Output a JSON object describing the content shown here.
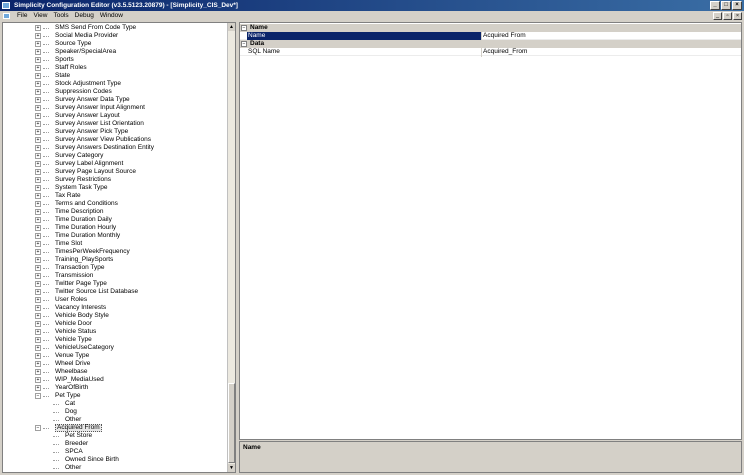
{
  "window": {
    "title": "Simplicity Configuration Editor (v3.5.5123.20879) - [Simplicity_CIS_Dev*]"
  },
  "menu": [
    "File",
    "View",
    "Tools",
    "Debug",
    "Window"
  ],
  "tree": {
    "items": [
      {
        "label": "SMS Send From Code Type",
        "level": 1,
        "expander": "+"
      },
      {
        "label": "Social Media Provider",
        "level": 1,
        "expander": "+"
      },
      {
        "label": "Source Type",
        "level": 1,
        "expander": "+"
      },
      {
        "label": "Speaker/SpecialArea",
        "level": 1,
        "expander": "+"
      },
      {
        "label": "Sports",
        "level": 1,
        "expander": "+"
      },
      {
        "label": "Staff Roles",
        "level": 1,
        "expander": "+"
      },
      {
        "label": "State",
        "level": 1,
        "expander": "+"
      },
      {
        "label": "Stock Adjustment Type",
        "level": 1,
        "expander": "+"
      },
      {
        "label": "Suppression Codes",
        "level": 1,
        "expander": "+"
      },
      {
        "label": "Survey Answer Data Type",
        "level": 1,
        "expander": "+"
      },
      {
        "label": "Survey Answer Input Alignment",
        "level": 1,
        "expander": "+"
      },
      {
        "label": "Survey Answer Layout",
        "level": 1,
        "expander": "+"
      },
      {
        "label": "Survey Answer List Orientation",
        "level": 1,
        "expander": "+"
      },
      {
        "label": "Survey Answer Pick Type",
        "level": 1,
        "expander": "+"
      },
      {
        "label": "Survey Answer View Publications",
        "level": 1,
        "expander": "+"
      },
      {
        "label": "Survey Answers Destination Entity",
        "level": 1,
        "expander": "+"
      },
      {
        "label": "Survey Category",
        "level": 1,
        "expander": "+"
      },
      {
        "label": "Survey Label Alignment",
        "level": 1,
        "expander": "+"
      },
      {
        "label": "Survey Page Layout Source",
        "level": 1,
        "expander": "+"
      },
      {
        "label": "Survey Restrictions",
        "level": 1,
        "expander": "+"
      },
      {
        "label": "System Task Type",
        "level": 1,
        "expander": "+"
      },
      {
        "label": "Tax Rate",
        "level": 1,
        "expander": "+"
      },
      {
        "label": "Terms and Conditions",
        "level": 1,
        "expander": "+"
      },
      {
        "label": "Time Description",
        "level": 1,
        "expander": "+"
      },
      {
        "label": "Time Duration Daily",
        "level": 1,
        "expander": "+"
      },
      {
        "label": "Time Duration Hourly",
        "level": 1,
        "expander": "+"
      },
      {
        "label": "Time Duration Monthly",
        "level": 1,
        "expander": "+"
      },
      {
        "label": "Time Slot",
        "level": 1,
        "expander": "+"
      },
      {
        "label": "TimesPerWeekFrequency",
        "level": 1,
        "expander": "+"
      },
      {
        "label": "Training_PlaySports",
        "level": 1,
        "expander": "+"
      },
      {
        "label": "Transaction Type",
        "level": 1,
        "expander": "+"
      },
      {
        "label": "Transmission",
        "level": 1,
        "expander": "+"
      },
      {
        "label": "Twitter Page Type",
        "level": 1,
        "expander": "+"
      },
      {
        "label": "Twitter Source List Database",
        "level": 1,
        "expander": "+"
      },
      {
        "label": "User Roles",
        "level": 1,
        "expander": "+"
      },
      {
        "label": "Vacancy Interests",
        "level": 1,
        "expander": "+"
      },
      {
        "label": "Vehicle Body Style",
        "level": 1,
        "expander": "+"
      },
      {
        "label": "Vehicle Door",
        "level": 1,
        "expander": "+"
      },
      {
        "label": "Vehicle Status",
        "level": 1,
        "expander": "+"
      },
      {
        "label": "Vehicle Type",
        "level": 1,
        "expander": "+"
      },
      {
        "label": "VehicleUseCategory",
        "level": 1,
        "expander": "+"
      },
      {
        "label": "Venue Type",
        "level": 1,
        "expander": "+"
      },
      {
        "label": "Wheel Drive",
        "level": 1,
        "expander": "+"
      },
      {
        "label": "Wheelbase",
        "level": 1,
        "expander": "+"
      },
      {
        "label": "WIP_MediaUsed",
        "level": 1,
        "expander": "+"
      },
      {
        "label": "YearOfBirth",
        "level": 1,
        "expander": "+"
      },
      {
        "label": "Pet Type",
        "level": 1,
        "expander": "-"
      },
      {
        "label": "Cat",
        "level": 2,
        "expander": ""
      },
      {
        "label": "Dog",
        "level": 2,
        "expander": ""
      },
      {
        "label": "Other",
        "level": 2,
        "expander": ""
      },
      {
        "label": "Acquired From",
        "level": 1,
        "expander": "-",
        "selected": true
      },
      {
        "label": "Pet Store",
        "level": 2,
        "expander": ""
      },
      {
        "label": "Breeder",
        "level": 2,
        "expander": ""
      },
      {
        "label": "SPCA",
        "level": 2,
        "expander": ""
      },
      {
        "label": "Owned Since Birth",
        "level": 2,
        "expander": ""
      },
      {
        "label": "Other",
        "level": 2,
        "expander": ""
      }
    ]
  },
  "properties": {
    "categories": [
      {
        "title": "Name",
        "rows": [
          {
            "name": "Name",
            "value": "Acquired From",
            "selected": true
          }
        ]
      },
      {
        "title": "Data",
        "rows": [
          {
            "name": "SQL Name",
            "value": "Acquired_From",
            "selected": false
          }
        ]
      }
    ]
  },
  "description": {
    "title": "Name"
  }
}
